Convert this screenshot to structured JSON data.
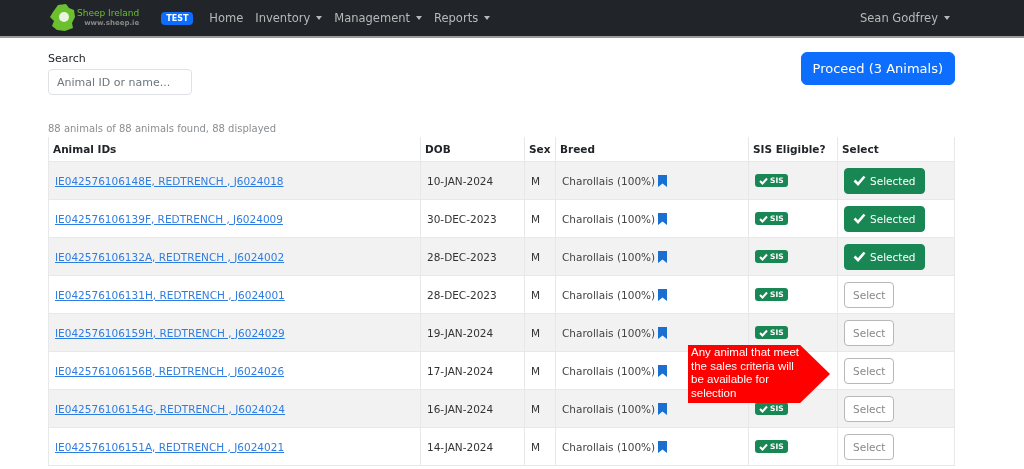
{
  "navbar": {
    "logo": {
      "name": "Sheep Ireland",
      "url": "www.sheep.ie"
    },
    "env_badge": "TEST",
    "items": [
      {
        "label": "Home",
        "dropdown": false
      },
      {
        "label": "Inventory",
        "dropdown": true
      },
      {
        "label": "Management",
        "dropdown": true
      },
      {
        "label": "Reports",
        "dropdown": true
      }
    ],
    "user": "Sean Godfrey"
  },
  "search": {
    "label": "Search",
    "placeholder": "Animal ID or name..."
  },
  "proceed_button": "Proceed (3 Animals)",
  "summary": "88 animals of 88 animals found, 88 displayed",
  "table": {
    "columns": [
      "Animal IDs",
      "DOB",
      "Sex",
      "Breed",
      "SIS Eligible?",
      "Select"
    ],
    "rows": [
      {
        "id": "IE042576106148E, REDTRENCH , J6024018",
        "dob": "10-JAN-2024",
        "sex": "M",
        "breed": "Charollais (100%)",
        "sis": "SIS",
        "button": "Selected",
        "selected": true
      },
      {
        "id": "IE042576106139F, REDTRENCH , J6024009",
        "dob": "30-DEC-2023",
        "sex": "M",
        "breed": "Charollais (100%)",
        "sis": "SIS",
        "button": "Selected",
        "selected": true
      },
      {
        "id": "IE042576106132A, REDTRENCH , J6024002",
        "dob": "28-DEC-2023",
        "sex": "M",
        "breed": "Charollais (100%)",
        "sis": "SIS",
        "button": "Selected",
        "selected": true
      },
      {
        "id": "IE042576106131H, REDTRENCH , J6024001",
        "dob": "28-DEC-2023",
        "sex": "M",
        "breed": "Charollais (100%)",
        "sis": "SIS",
        "button": "Select",
        "selected": false
      },
      {
        "id": "IE042576106159H, REDTRENCH , J6024029",
        "dob": "19-JAN-2024",
        "sex": "M",
        "breed": "Charollais (100%)",
        "sis": "SIS",
        "button": "Select",
        "selected": false
      },
      {
        "id": "IE042576106156B, REDTRENCH , J6024026",
        "dob": "17-JAN-2024",
        "sex": "M",
        "breed": "Charollais (100%)",
        "button": "Select",
        "selected": false
      },
      {
        "id": "IE042576106154G, REDTRENCH , J6024024",
        "dob": "16-JAN-2024",
        "sex": "M",
        "breed": "Charollais (100%)",
        "sis": "SIS",
        "button": "Select",
        "selected": false
      },
      {
        "id": "IE042576106151A, REDTRENCH , J6024021",
        "dob": "14-JAN-2024",
        "sex": "M",
        "breed": "Charollais (100%)",
        "sis": "SIS",
        "button": "Select",
        "selected": false
      }
    ]
  },
  "callout": "Any animal that meet the sales criteria will be available for selection"
}
